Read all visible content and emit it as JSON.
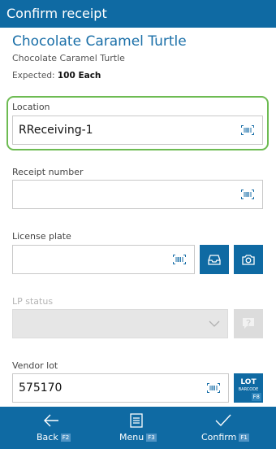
{
  "window": {
    "title": "Confirm receipt"
  },
  "product": {
    "name": "Chocolate Caramel Turtle",
    "subtitle": "Chocolate Caramel Turtle",
    "expected_label": "Expected:",
    "expected_value": "100 Each"
  },
  "fields": {
    "location": {
      "label": "Location",
      "value": "RReceiving-1"
    },
    "receipt_number": {
      "label": "Receipt number",
      "value": ""
    },
    "license_plate": {
      "label": "License plate",
      "value": ""
    },
    "lp_status": {
      "label": "LP status",
      "value": ""
    },
    "vendor_lot": {
      "label": "Vendor lot",
      "value": "575170"
    }
  },
  "lot_button": {
    "line1": "LOT",
    "line2": "BARCODE",
    "key": "F8"
  },
  "bottom_bar": {
    "back": {
      "label": "Back",
      "key": "F2"
    },
    "menu": {
      "label": "Menu",
      "key": "F3"
    },
    "confirm": {
      "label": "Confirm",
      "key": "F1"
    }
  },
  "colors": {
    "accent": "#0f6aa3",
    "focus": "#6dbb52",
    "title_text": "#1a6fa8"
  }
}
